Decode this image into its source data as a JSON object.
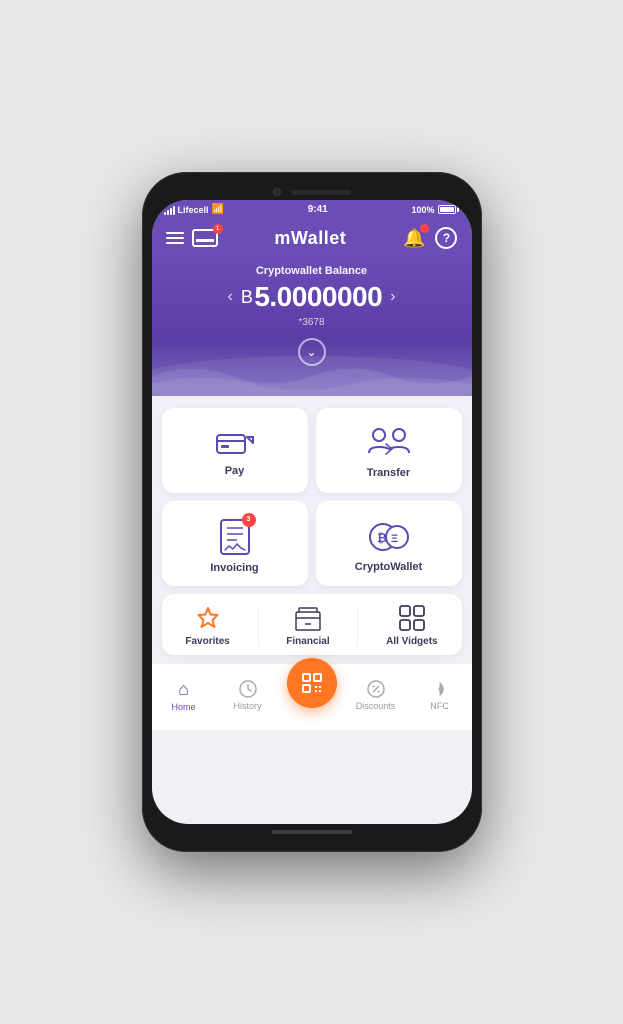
{
  "status_bar": {
    "carrier": "Lifecell",
    "time": "9:41",
    "battery": "100%"
  },
  "header": {
    "title": "mWallet",
    "card_badge": "1"
  },
  "balance": {
    "label": "Cryptowallet Balance",
    "currency_symbol": "B",
    "amount": "5.0000000",
    "account": "*3678"
  },
  "grid_cards": [
    {
      "id": "pay",
      "label": "Pay",
      "badge": null
    },
    {
      "id": "transfer",
      "label": "Transfer",
      "badge": null
    },
    {
      "id": "invoicing",
      "label": "Invoicing",
      "badge": "3"
    },
    {
      "id": "cryptowallet",
      "label": "CryptoWallet",
      "badge": null
    }
  ],
  "widgets": [
    {
      "id": "favorites",
      "label": "Favorites"
    },
    {
      "id": "financial",
      "label": "Financial"
    },
    {
      "id": "all-vidgets",
      "label": "All Vidgets"
    }
  ],
  "bottom_nav": [
    {
      "id": "home",
      "label": "Home",
      "active": true
    },
    {
      "id": "history",
      "label": "History",
      "active": false
    },
    {
      "id": "scan",
      "label": "",
      "active": false,
      "is_fab": true
    },
    {
      "id": "discounts",
      "label": "Discounts",
      "active": false
    },
    {
      "id": "nfc",
      "label": "NFC",
      "active": false
    }
  ],
  "colors": {
    "purple": "#6B4DB5",
    "orange": "#FF7722",
    "red": "#ff4444",
    "text_dark": "#3a3a5c",
    "bg": "#f0f0f8"
  }
}
